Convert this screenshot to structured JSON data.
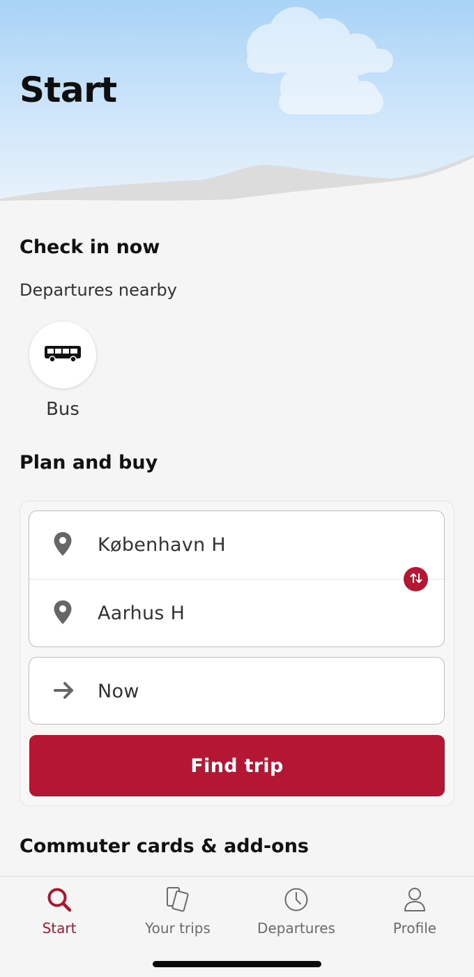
{
  "header": {
    "title": "Start"
  },
  "check_in": {
    "title": "Check in now",
    "subtitle": "Departures nearby",
    "options": [
      {
        "label": "Bus",
        "icon": "bus-icon"
      }
    ]
  },
  "plan": {
    "title": "Plan and buy",
    "from": {
      "value": "København H",
      "icon": "location-pin-icon"
    },
    "to": {
      "value": "Aarhus H",
      "icon": "location-pin-icon"
    },
    "time": {
      "value": "Now",
      "icon": "arrow-right-icon"
    },
    "swap_icon": "swap-vertical-icon",
    "find_button": "Find trip"
  },
  "commuter": {
    "title": "Commuter cards & add-ons"
  },
  "tabbar": {
    "tabs": [
      {
        "label": "Start",
        "icon": "search-icon",
        "active": true
      },
      {
        "label": "Your trips",
        "icon": "tickets-icon",
        "active": false
      },
      {
        "label": "Departures",
        "icon": "clock-icon",
        "active": false
      },
      {
        "label": "Profile",
        "icon": "person-icon",
        "active": false
      }
    ]
  },
  "colors": {
    "accent": "#b31733",
    "active_tab": "#a8162f",
    "sky_top": "#a9d3f7",
    "background": "#f5f5f5"
  }
}
